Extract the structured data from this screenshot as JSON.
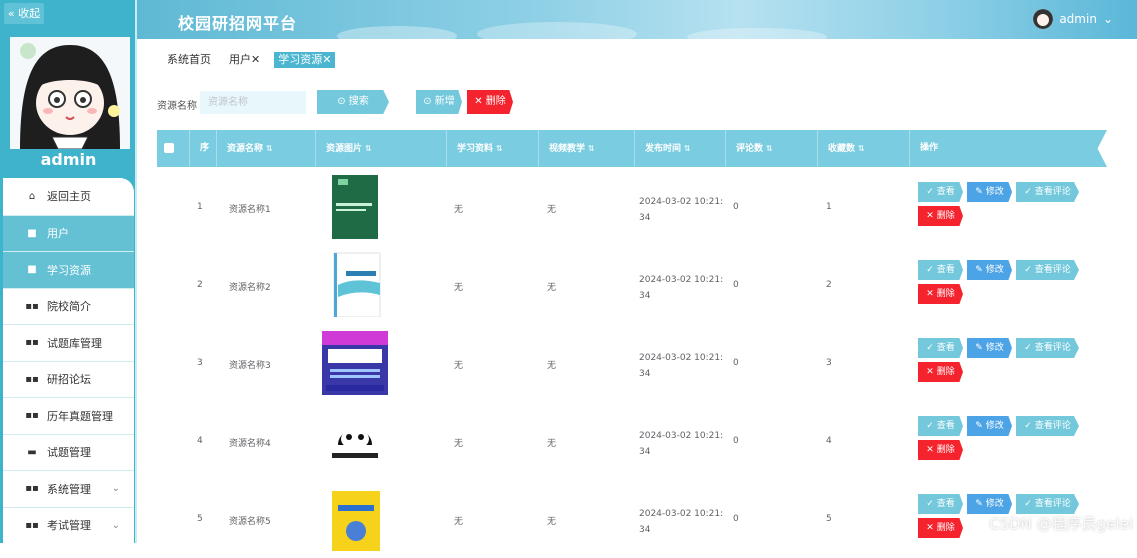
{
  "sidebar": {
    "collapse_label": "« 收起",
    "username": "admin",
    "items": [
      {
        "label": "返回主页",
        "icon": "home-icon",
        "glyph": "⌂",
        "active": false
      },
      {
        "label": "用户",
        "icon": "user-icon",
        "glyph": "■",
        "active": true
      },
      {
        "label": "学习资源",
        "icon": "book-icon",
        "glyph": "■",
        "active": true
      },
      {
        "label": "院校简介",
        "icon": "grid-icon",
        "glyph": "▪▪",
        "active": false
      },
      {
        "label": "试题库管理",
        "icon": "grid-icon",
        "glyph": "▪▪",
        "active": false
      },
      {
        "label": "研招论坛",
        "icon": "grid-icon",
        "glyph": "▪▪",
        "active": false
      },
      {
        "label": "历年真题管理",
        "icon": "grid-icon",
        "glyph": "▪▪",
        "active": false
      },
      {
        "label": "试题管理",
        "icon": "list-icon",
        "glyph": "▬",
        "active": false
      },
      {
        "label": "系统管理",
        "icon": "grid-icon",
        "glyph": "▪▪",
        "active": false,
        "expandable": true
      },
      {
        "label": "考试管理",
        "icon": "grid-icon",
        "glyph": "▪▪",
        "active": false,
        "expandable": true
      }
    ]
  },
  "header": {
    "title": "校园研招网平台",
    "user": "admin"
  },
  "tabs": [
    {
      "label": "系统首页",
      "active": false
    },
    {
      "label": "用户✕",
      "active": false
    },
    {
      "label": "学习资源✕",
      "active": true
    }
  ],
  "search": {
    "label": "资源名称",
    "placeholder": "资源名称",
    "search_btn": "⊙ 搜索",
    "add_btn": "⊙ 新增",
    "delete_btn": "✕ 删除"
  },
  "table": {
    "headers": [
      "序号",
      "资源名称",
      "资源图片",
      "学习资料",
      "视频教学",
      "发布时间",
      "评论数",
      "收藏数",
      "操作"
    ],
    "actions": {
      "view": "✓ 查看",
      "edit": "✎ 修改",
      "comments": "✓ 查看评论",
      "delete": "✕ 删除"
    },
    "rows": [
      {
        "no": "1",
        "name": "资源名称1",
        "image": "book-cover-green",
        "material": "无",
        "video": "无",
        "time": "2024-03-02 10:21:34",
        "comments": "0",
        "favorites": "1"
      },
      {
        "no": "2",
        "name": "资源名称2",
        "image": "book-cover-database",
        "material": "无",
        "video": "无",
        "time": "2024-03-02 10:21:34",
        "comments": "0",
        "favorites": "2"
      },
      {
        "no": "3",
        "name": "资源名称3",
        "image": "program-design-banner",
        "material": "无",
        "video": "无",
        "time": "2024-03-02 10:21:34",
        "comments": "0",
        "favorites": "3"
      },
      {
        "no": "4",
        "name": "资源名称4",
        "image": "panda-logo",
        "material": "无",
        "video": "无",
        "time": "2024-03-02 10:21:34",
        "comments": "0",
        "favorites": "4"
      },
      {
        "no": "5",
        "name": "资源名称5",
        "image": "python-book",
        "material": "无",
        "video": "无",
        "time": "2024-03-02 10:21:34",
        "comments": "0",
        "favorites": "5"
      }
    ]
  },
  "watermark": "CSDN @程序员gelei",
  "colors": {
    "primary": "#74c8dc",
    "header": "#7acce0",
    "danger": "#f5232d",
    "edit": "#4ca3e6",
    "sidebar": "#3fb3cc"
  }
}
